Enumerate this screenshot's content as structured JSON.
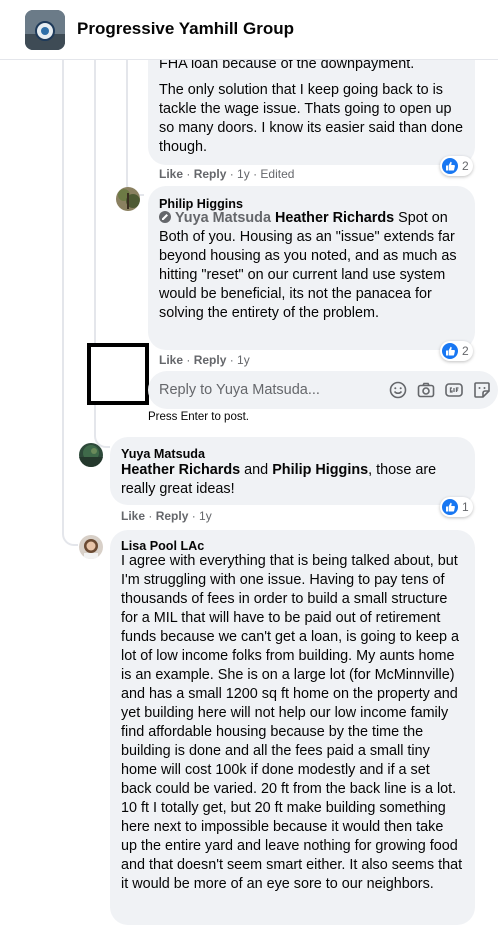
{
  "header": {
    "group_name": "Progressive Yamhill Group"
  },
  "comment1": {
    "line_cut": "FHA loan because of the downpayment.",
    "text": "The only solution that I keep going back to is tackle the wage issue. Thats going to open up so many doors. I know its easier said than done though.",
    "like": "Like",
    "reply": "Reply",
    "time": "1y",
    "edited": "Edited",
    "reaction_count": "2"
  },
  "comment2": {
    "author": "Philip Higgins",
    "mention1": "Yuya Matsuda",
    "mention2": "Heather Richards",
    "text": "Spot on Both of you. Housing as an \"issue\" extends far beyond housing as you noted, and as much as hitting \"reset\" on our current land use system would be beneficial, its not the panacea for solving the entirety of the problem.",
    "like": "Like",
    "reply": "Reply",
    "time": "1y",
    "reaction_count": "2"
  },
  "reply_box": {
    "placeholder": "Reply to Yuya Matsuda...",
    "hint": "Press Enter to post."
  },
  "comment3": {
    "author": "Yuya Matsuda",
    "mention1": "Heather Richards",
    "and": "and",
    "mention2": "Philip Higgins",
    "text": ", those are really great ideas!",
    "like": "Like",
    "reply": "Reply",
    "time": "1y",
    "reaction_count": "1"
  },
  "comment4": {
    "author": "Lisa Pool LAc",
    "text": "I agree with everything that is being talked about, but I'm struggling with one issue. Having to pay tens of thousands of fees in order to build a small structure for a MIL that will have to be paid out of retirement funds because we can't get a loan, is going to keep a lot of low income folks from building. My aunts home is an example. She is on a large lot (for McMinnville) and has a small 1200 sq ft home on the property and yet building here will not help our low income family find affordable housing because by the time the building is done and all the fees paid a small tiny home will cost 100k if done modestly and if a set back could be varied. 20 ft from the back line is a lot. 10 ft I totally get, but 20 ft make building something here next to impossible because it would then take up the entire yard and leave nothing for growing food and that doesn't seem smart either. It also seems that it would be more of an eye sore to our neighbors."
  },
  "colors": {
    "accent": "#1877f2",
    "bubble": "#f0f2f5",
    "meta": "#65676b"
  }
}
